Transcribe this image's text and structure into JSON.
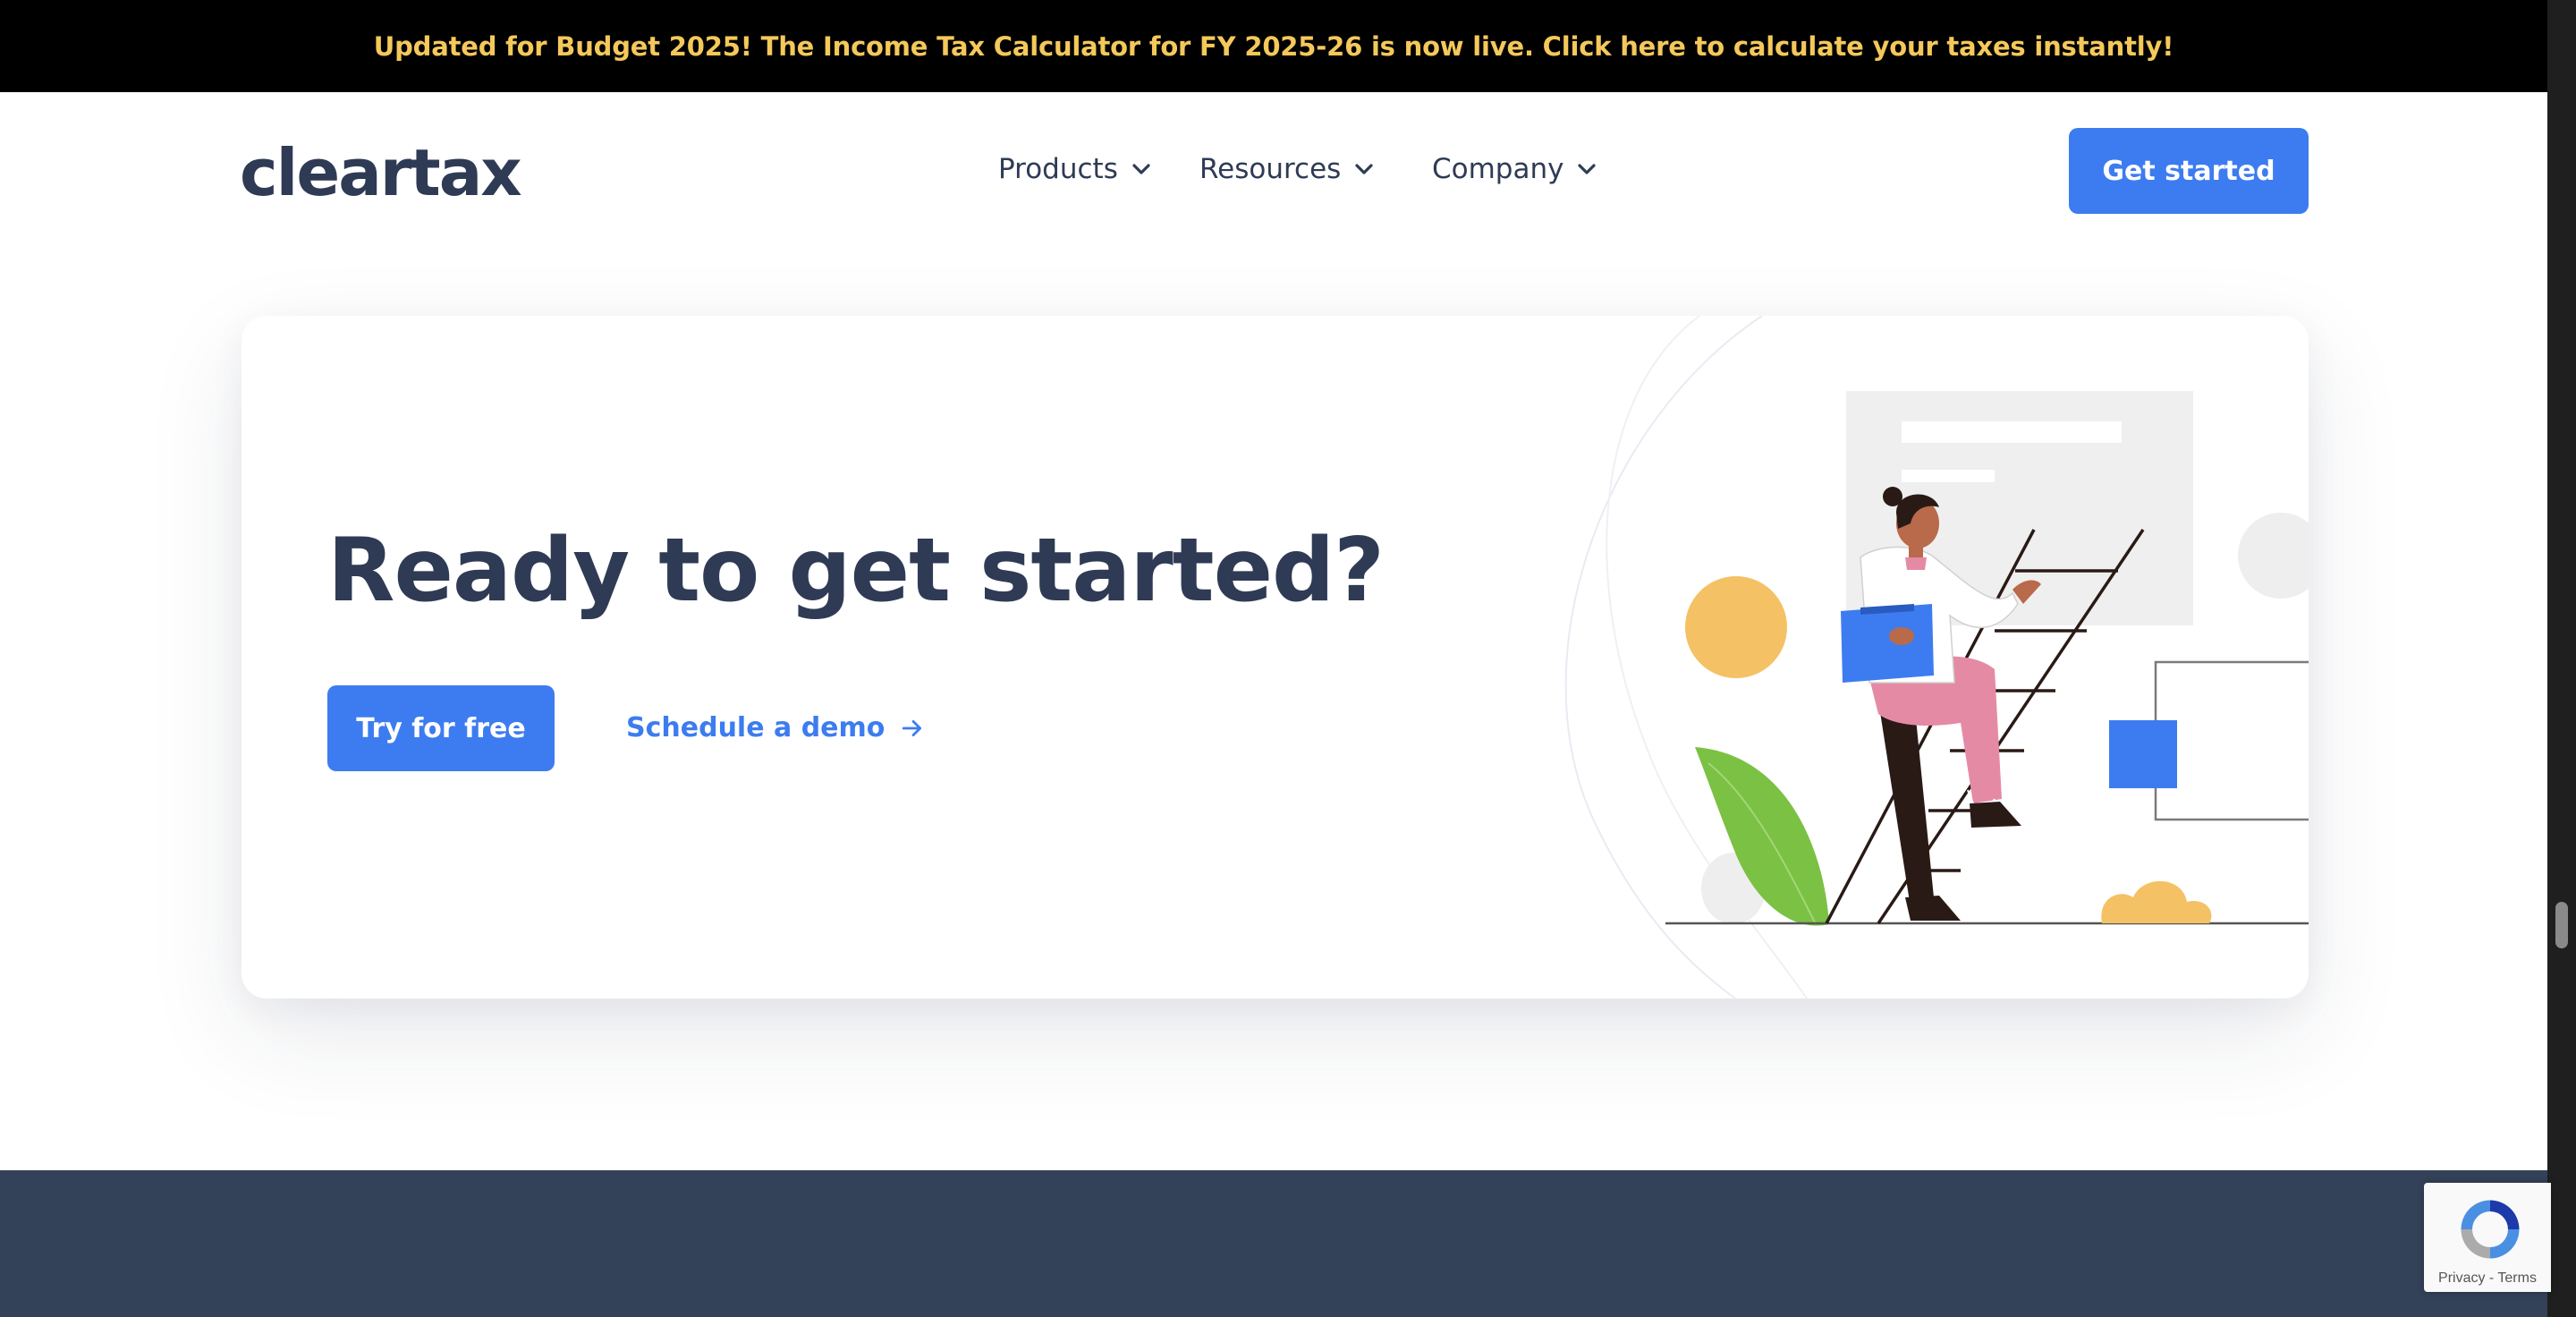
{
  "announcement": {
    "text": "Updated for Budget 2025! The Income Tax Calculator for FY 2025-26 is now live. Click here to calculate your taxes instantly!",
    "color": "#f4c85a"
  },
  "header": {
    "logo": "cleartax",
    "nav": [
      {
        "label": "Products",
        "icon": "chevron-down-icon"
      },
      {
        "label": "Resources",
        "icon": "chevron-down-icon"
      },
      {
        "label": "Company",
        "icon": "chevron-down-icon"
      }
    ],
    "cta_label": "Get started"
  },
  "cta": {
    "title": "Ready to get started?",
    "primary_label": "Try for free",
    "secondary_label": "Schedule a demo",
    "secondary_icon": "arrow-right-icon"
  },
  "recaptcha": {
    "privacy": "Privacy",
    "separator": " - ",
    "terms": "Terms"
  },
  "colors": {
    "accent": "#3d7cf0",
    "text": "#2f3b55",
    "footer": "#344259",
    "yellow": "#f4c85a",
    "pink": "#e58aa5",
    "green": "#7bc143"
  }
}
